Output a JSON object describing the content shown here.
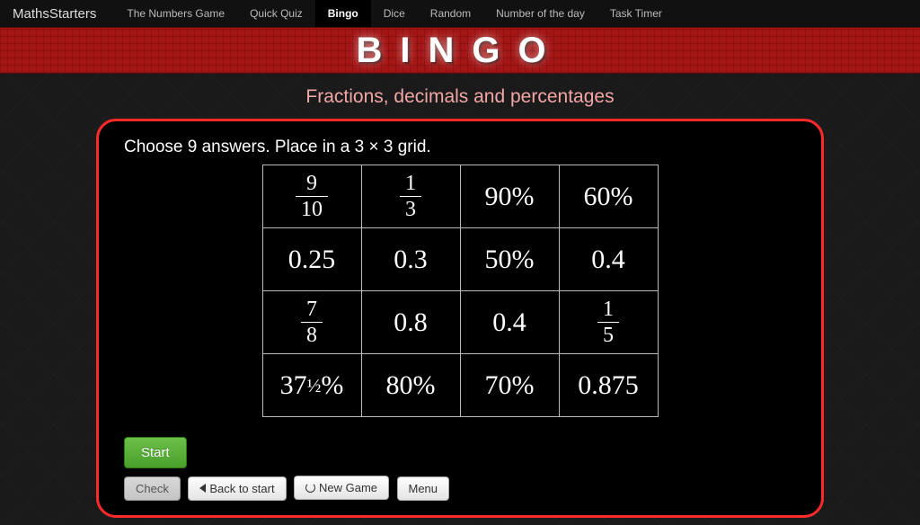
{
  "brand": "MathsStarters",
  "nav": [
    {
      "label": "The Numbers Game",
      "active": false
    },
    {
      "label": "Quick Quiz",
      "active": false
    },
    {
      "label": "Bingo",
      "active": true
    },
    {
      "label": "Dice",
      "active": false
    },
    {
      "label": "Random",
      "active": false
    },
    {
      "label": "Number of the day",
      "active": false
    },
    {
      "label": "Task Timer",
      "active": false
    }
  ],
  "banner_title": "BINGO",
  "subtitle": "Fractions, decimals and percentages",
  "instruction": "Choose 9 answers. Place in a 3 × 3 grid.",
  "grid": [
    [
      {
        "type": "fraction",
        "num": "9",
        "den": "10"
      },
      {
        "type": "fraction",
        "num": "1",
        "den": "3"
      },
      {
        "type": "text",
        "value": "90%"
      },
      {
        "type": "text",
        "value": "60%"
      }
    ],
    [
      {
        "type": "text",
        "value": "0.25"
      },
      {
        "type": "text",
        "value": "0.3"
      },
      {
        "type": "text",
        "value": "50%"
      },
      {
        "type": "text",
        "value": "0.4"
      }
    ],
    [
      {
        "type": "fraction",
        "num": "7",
        "den": "8"
      },
      {
        "type": "text",
        "value": "0.8"
      },
      {
        "type": "text",
        "value": "0.4"
      },
      {
        "type": "fraction",
        "num": "1",
        "den": "5"
      }
    ],
    [
      {
        "type": "mixedpercent",
        "whole": "37",
        "half": "½",
        "suffix": "%"
      },
      {
        "type": "text",
        "value": "80%"
      },
      {
        "type": "text",
        "value": "70%"
      },
      {
        "type": "text",
        "value": "0.875"
      }
    ]
  ],
  "buttons": {
    "start": "Start",
    "check": "Check",
    "back": "Back to start",
    "newgame": "New Game",
    "menu": "Menu"
  }
}
